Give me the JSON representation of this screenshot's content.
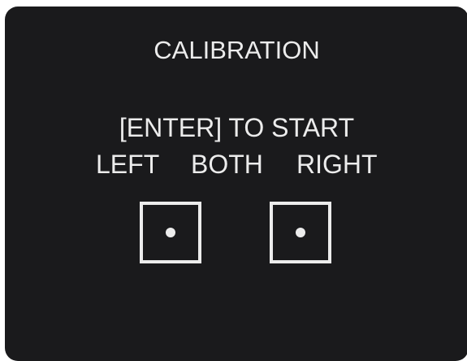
{
  "calibration": {
    "title": "CALIBRATION",
    "prompt": "[ENTER] TO START",
    "options": {
      "left": "LEFT",
      "both": "BOTH",
      "right": "RIGHT"
    }
  },
  "colors": {
    "background": "#1a1a1c",
    "foreground": "#ececec"
  }
}
